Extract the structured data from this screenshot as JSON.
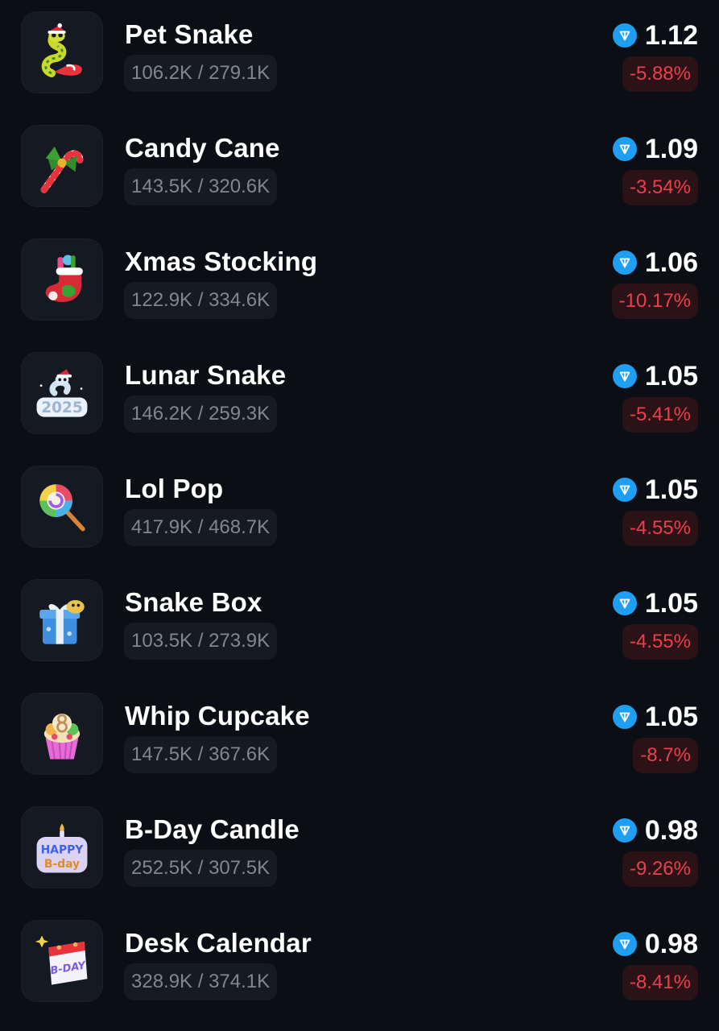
{
  "gifts": [
    {
      "name": "Pet Snake",
      "supply": "106.2K / 279.1K",
      "price": "1.12",
      "change": "-5.88%",
      "icon": "pet-snake-icon"
    },
    {
      "name": "Candy Cane",
      "supply": "143.5K / 320.6K",
      "price": "1.09",
      "change": "-3.54%",
      "icon": "candy-cane-icon"
    },
    {
      "name": "Xmas Stocking",
      "supply": "122.9K / 334.6K",
      "price": "1.06",
      "change": "-10.17%",
      "icon": "xmas-stocking-icon"
    },
    {
      "name": "Lunar Snake",
      "supply": "146.2K / 259.3K",
      "price": "1.05",
      "change": "-5.41%",
      "icon": "lunar-snake-icon"
    },
    {
      "name": "Lol Pop",
      "supply": "417.9K / 468.7K",
      "price": "1.05",
      "change": "-4.55%",
      "icon": "lollipop-icon"
    },
    {
      "name": "Snake Box",
      "supply": "103.5K / 273.9K",
      "price": "1.05",
      "change": "-4.55%",
      "icon": "snake-box-icon"
    },
    {
      "name": "Whip Cupcake",
      "supply": "147.5K / 367.6K",
      "price": "1.05",
      "change": "-8.7%",
      "icon": "cupcake-icon"
    },
    {
      "name": "B-Day Candle",
      "supply": "252.5K / 307.5K",
      "price": "0.98",
      "change": "-9.26%",
      "icon": "birthday-candle-icon"
    },
    {
      "name": "Desk Calendar",
      "supply": "328.9K / 374.1K",
      "price": "0.98",
      "change": "-8.41%",
      "icon": "desk-calendar-icon"
    }
  ],
  "icon_labels": {
    "lunar_snake_year": "2025",
    "bday_top": "HAPPY",
    "bday_bottom": "B-day",
    "calendar": "B-DAY"
  },
  "colors": {
    "background": "#0b0e15",
    "card": "#141922",
    "ton": "#1f9ff2",
    "negative": "#ec3f4a",
    "negative_bg": "#2a1216"
  }
}
